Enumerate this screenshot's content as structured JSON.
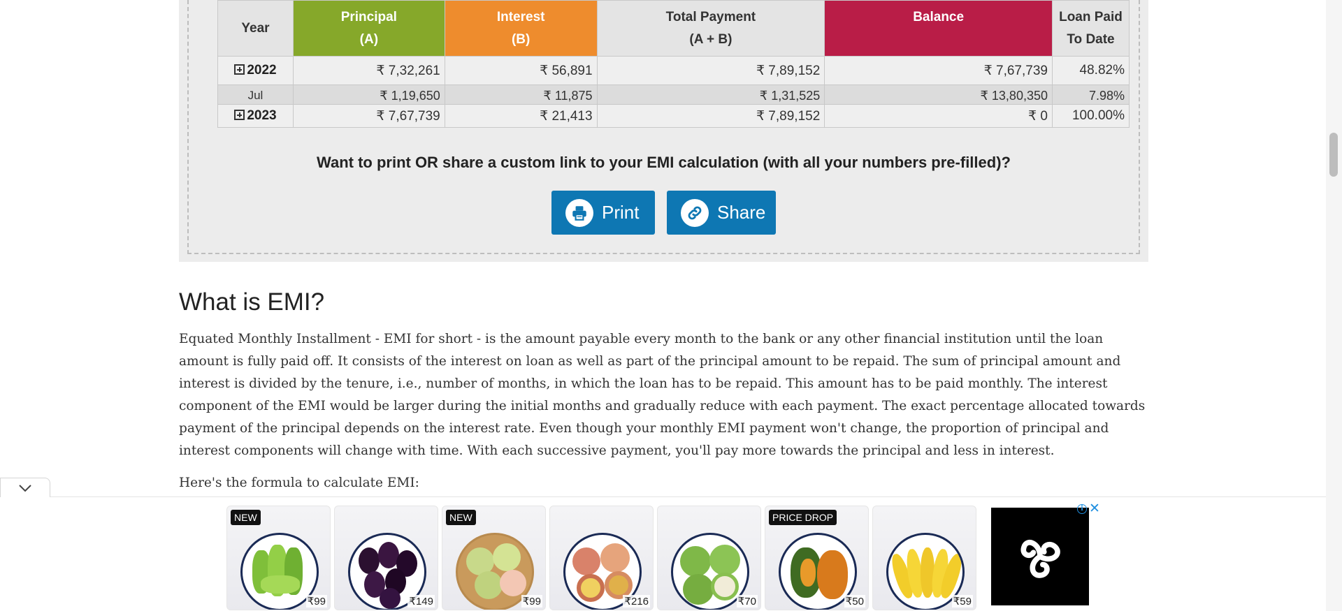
{
  "schedule": {
    "headers": {
      "year": "Year",
      "principal": [
        "Principal",
        "(A)"
      ],
      "interest": [
        "Interest",
        "(B)"
      ],
      "total": [
        "Total Payment",
        "(A + B)"
      ],
      "balance": "Balance",
      "paid": [
        "Loan Paid",
        "To Date"
      ]
    },
    "rows": [
      {
        "year": "2022",
        "principal": "₹ 7,32,261",
        "interest": "₹ 56,891",
        "total": "₹ 7,89,152",
        "balance": "₹ 7,67,739",
        "paid": "48.82%"
      },
      {
        "month": "Jul",
        "principal": "₹ 1,19,650",
        "interest": "₹ 11,875",
        "total": "₹ 1,31,525",
        "balance": "₹ 13,80,350",
        "paid": "7.98%"
      },
      {
        "year": "2023",
        "principal": "₹ 7,67,739",
        "interest": "₹ 21,413",
        "total": "₹ 7,89,152",
        "balance": "₹ 0",
        "paid": "100.00%"
      }
    ]
  },
  "share": {
    "question": "Want to print OR share a custom link to your EMI calculation (with all your numbers pre-filled)?",
    "print_label": "Print",
    "share_label": "Share"
  },
  "article": {
    "heading": "What is EMI?",
    "paragraph": "Equated Monthly Installment - EMI for short - is the amount payable every month to the bank or any other financial institution until the loan amount is fully paid off. It consists of the interest on loan as well as part of the principal amount to be repaid. The sum of principal amount and interest is divided by the tenure, i.e., number of months, in which the loan has to be repaid. This amount has to be paid monthly. The interest component of the EMI would be larger during the initial months and gradually reduce with each payment. The exact percentage allocated towards payment of the principal depends on the interest rate. Even though your monthly EMI payment won't change, the proportion of principal and interest components will change with time. With each successive payment, you'll pay more towards the principal and less in interest.",
    "formula_intro": "Here's the formula to calculate EMI:"
  },
  "ad": {
    "products": [
      {
        "badge": "NEW",
        "price": "₹99",
        "icon": "star-fruit"
      },
      {
        "badge": "",
        "price": "₹149",
        "icon": "jamun"
      },
      {
        "badge": "NEW",
        "price": "₹99",
        "icon": "guava-basket"
      },
      {
        "badge": "",
        "price": "₹216",
        "icon": "passion-fruit"
      },
      {
        "badge": "",
        "price": "₹70",
        "icon": "guava"
      },
      {
        "badge": "PRICE DROP",
        "price": "₹50",
        "icon": "papaya"
      },
      {
        "badge": "",
        "price": "₹59",
        "icon": "banana"
      }
    ],
    "info_glyph": "i",
    "close_glyph": "✕"
  },
  "colors": {
    "principal": "#86a82a",
    "interest": "#ee8c2d",
    "balance": "#b91d47",
    "button": "#0e77b3"
  }
}
